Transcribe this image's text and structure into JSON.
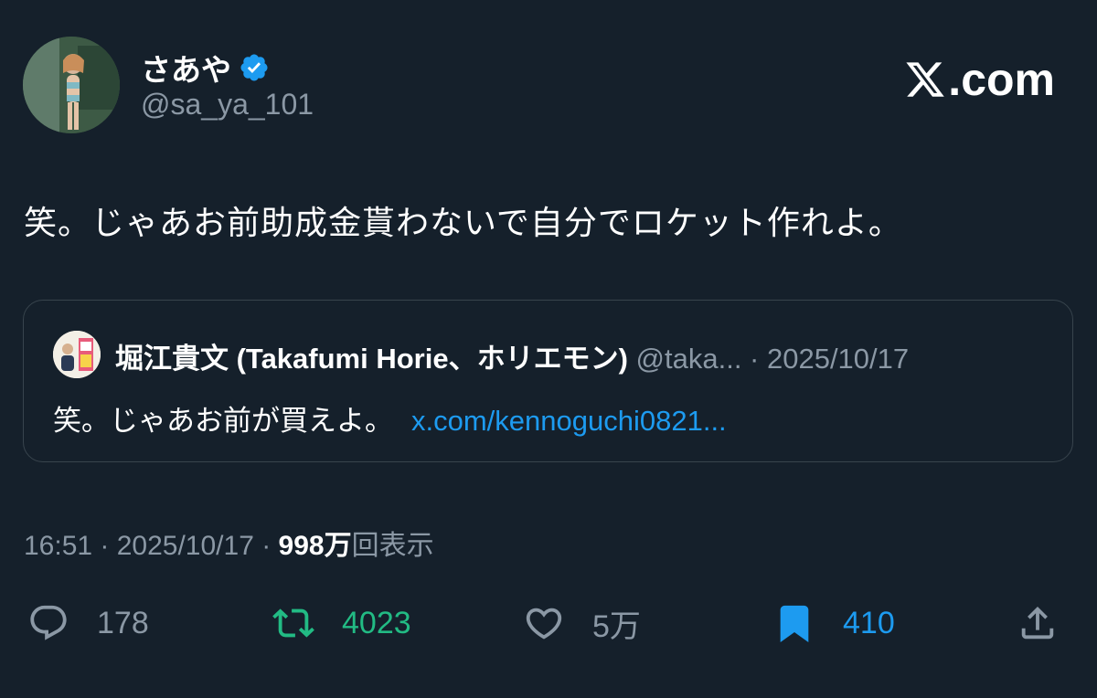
{
  "author": {
    "name": "さあや",
    "handle": "@sa_ya_101",
    "verified_color": "#1d9bf0"
  },
  "brand": {
    "logo_text": ".com"
  },
  "tweet": {
    "text": "笑。じゃあお前助成金貰わないで自分でロケット作れよ。"
  },
  "quote": {
    "author_name": "堀江貴文 (Takafumi Horie、ホリエモン)",
    "meta": "@taka... · 2025/10/17",
    "text": "笑。じゃあお前が買えよ。",
    "link": "x.com/kennoguchi0821..."
  },
  "meta": {
    "time_date": "16:51 · 2025/10/17 · ",
    "views_number": "998万",
    "views_label": "回表示"
  },
  "actions": {
    "replies": "178",
    "retweets": "4023",
    "likes": "5万",
    "bookmarks": "410"
  },
  "colors": {
    "background": "#15202b",
    "retweet_active": "#22bb84",
    "bookmark_active": "#1d9bf0",
    "secondary_text": "#8b98a5"
  }
}
